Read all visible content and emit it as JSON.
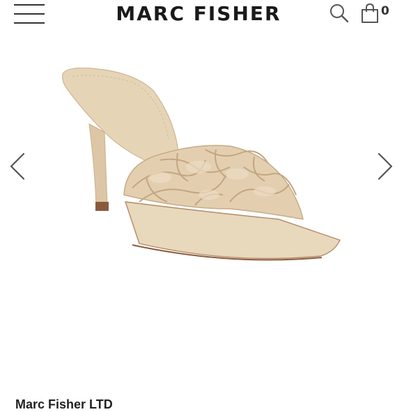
{
  "header": {
    "brand": "MARC FISHER",
    "cart_count": "0",
    "icons": [
      "menu-icon",
      "search-icon",
      "shopping-bag-icon"
    ]
  },
  "gallery": {
    "prev_icon": "chevron-left-icon",
    "next_icon": "chevron-right-icon",
    "image": "beige-woven-square-toe-stiletto-mule"
  },
  "product": {
    "title": "Marc Fisher LTD"
  },
  "colors": {
    "shoe": "#e3cfb0",
    "heel_tip": "#8a5a3c",
    "text": "#1a1a1a"
  }
}
